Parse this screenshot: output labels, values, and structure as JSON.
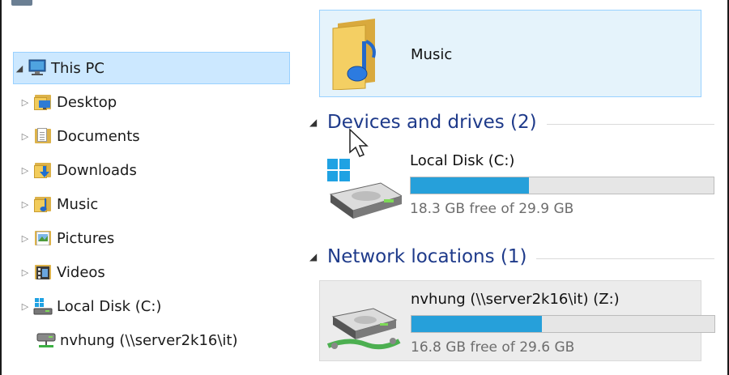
{
  "nav": {
    "items": [
      {
        "label": "This PC",
        "icon": "pc-icon",
        "expander": "expanded",
        "selected": true
      },
      {
        "label": "Desktop",
        "icon": "desktop-folder-icon",
        "expander": "collapsed"
      },
      {
        "label": "Documents",
        "icon": "documents-folder-icon",
        "expander": "collapsed"
      },
      {
        "label": "Downloads",
        "icon": "downloads-folder-icon",
        "expander": "collapsed"
      },
      {
        "label": "Music",
        "icon": "music-folder-icon",
        "expander": "collapsed"
      },
      {
        "label": "Pictures",
        "icon": "pictures-folder-icon",
        "expander": "collapsed"
      },
      {
        "label": "Videos",
        "icon": "videos-folder-icon",
        "expander": "collapsed"
      },
      {
        "label": "Local Disk (C:)",
        "icon": "windows-drive-icon",
        "expander": "collapsed"
      },
      {
        "label": "nvhung (\\\\server2k16\\it)",
        "icon": "network-drive-icon",
        "expander": "none"
      }
    ]
  },
  "folders": {
    "music": {
      "label": "Music"
    }
  },
  "groups": {
    "devices": {
      "title": "Devices and drives (2)"
    },
    "network": {
      "title": "Network locations (1)"
    }
  },
  "drives": {
    "local": {
      "name": "Local Disk (C:)",
      "free_text": "18.3 GB free of 29.9 GB",
      "used_fraction": 0.39,
      "bar_color": "#26a0da"
    },
    "network": {
      "name": "nvhung (\\\\server2k16\\it) (Z:)",
      "free_text": "16.8 GB free of 29.6 GB",
      "used_fraction": 0.43,
      "bar_color": "#26a0da"
    }
  },
  "colors": {
    "selection_fill": "#cce8ff",
    "selection_border": "#99d1ff",
    "group_title": "#1e3a8a"
  }
}
